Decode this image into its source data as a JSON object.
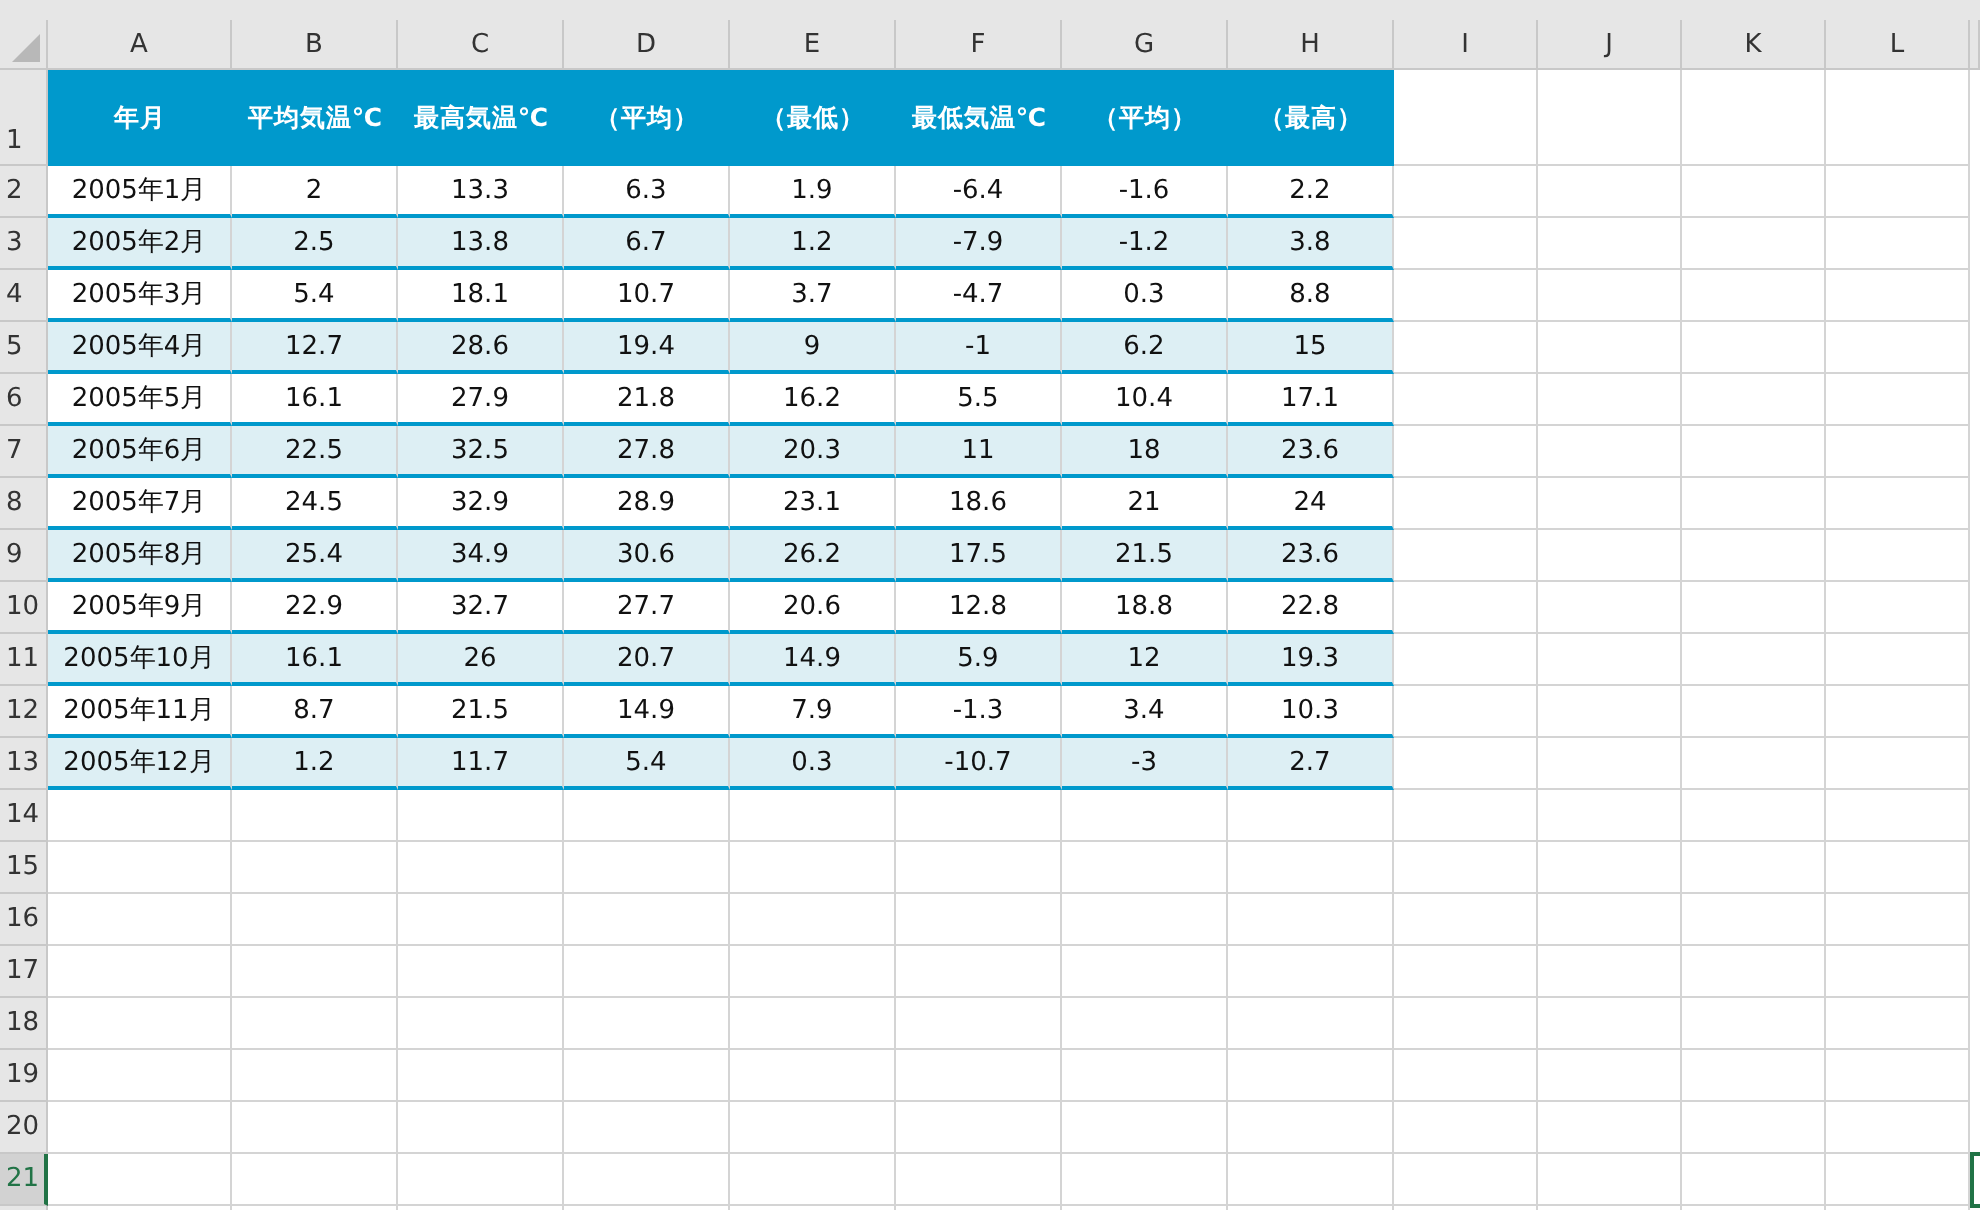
{
  "columns": [
    "A",
    "B",
    "C",
    "D",
    "E",
    "F",
    "G",
    "H",
    "I",
    "J",
    "K",
    "L"
  ],
  "table": {
    "headers": [
      "年月",
      "平均気温℃",
      "最高気温℃",
      "（平均）",
      "（最低）",
      "最低気温℃",
      "（平均）",
      "（最高）"
    ],
    "rows": [
      [
        "2005年1月",
        "2",
        "13.3",
        "6.3",
        "1.9",
        "-6.4",
        "-1.6",
        "2.2"
      ],
      [
        "2005年2月",
        "2.5",
        "13.8",
        "6.7",
        "1.2",
        "-7.9",
        "-1.2",
        "3.8"
      ],
      [
        "2005年3月",
        "5.4",
        "18.1",
        "10.7",
        "3.7",
        "-4.7",
        "0.3",
        "8.8"
      ],
      [
        "2005年4月",
        "12.7",
        "28.6",
        "19.4",
        "9",
        "-1",
        "6.2",
        "15"
      ],
      [
        "2005年5月",
        "16.1",
        "27.9",
        "21.8",
        "16.2",
        "5.5",
        "10.4",
        "17.1"
      ],
      [
        "2005年6月",
        "22.5",
        "32.5",
        "27.8",
        "20.3",
        "11",
        "18",
        "23.6"
      ],
      [
        "2005年7月",
        "24.5",
        "32.9",
        "28.9",
        "23.1",
        "18.6",
        "21",
        "24"
      ],
      [
        "2005年8月",
        "25.4",
        "34.9",
        "30.6",
        "26.2",
        "17.5",
        "21.5",
        "23.6"
      ],
      [
        "2005年9月",
        "22.9",
        "32.7",
        "27.7",
        "20.6",
        "12.8",
        "18.8",
        "22.8"
      ],
      [
        "2005年10月",
        "16.1",
        "26",
        "20.7",
        "14.9",
        "5.9",
        "12",
        "19.3"
      ],
      [
        "2005年11月",
        "8.7",
        "21.5",
        "14.9",
        "7.9",
        "-1.3",
        "3.4",
        "10.3"
      ],
      [
        "2005年12月",
        "1.2",
        "11.7",
        "5.4",
        "0.3",
        "-10.7",
        "-3",
        "2.7"
      ]
    ]
  },
  "row_headers": [
    {
      "label": "1",
      "selected": false
    },
    {
      "label": "2",
      "selected": false
    },
    {
      "label": "3",
      "selected": false
    },
    {
      "label": "4",
      "selected": false
    },
    {
      "label": "5",
      "selected": false
    },
    {
      "label": "6",
      "selected": false
    },
    {
      "label": "7",
      "selected": false
    },
    {
      "label": "8",
      "selected": false
    },
    {
      "label": "9",
      "selected": false
    },
    {
      "label": "10",
      "selected": false
    },
    {
      "label": "11",
      "selected": false
    },
    {
      "label": "12",
      "selected": false
    },
    {
      "label": "13",
      "selected": false
    },
    {
      "label": "14",
      "selected": false
    },
    {
      "label": "15",
      "selected": false
    },
    {
      "label": "16",
      "selected": false
    },
    {
      "label": "17",
      "selected": false
    },
    {
      "label": "18",
      "selected": false
    },
    {
      "label": "19",
      "selected": false
    },
    {
      "label": "20",
      "selected": false
    },
    {
      "label": "21",
      "selected": true
    }
  ]
}
